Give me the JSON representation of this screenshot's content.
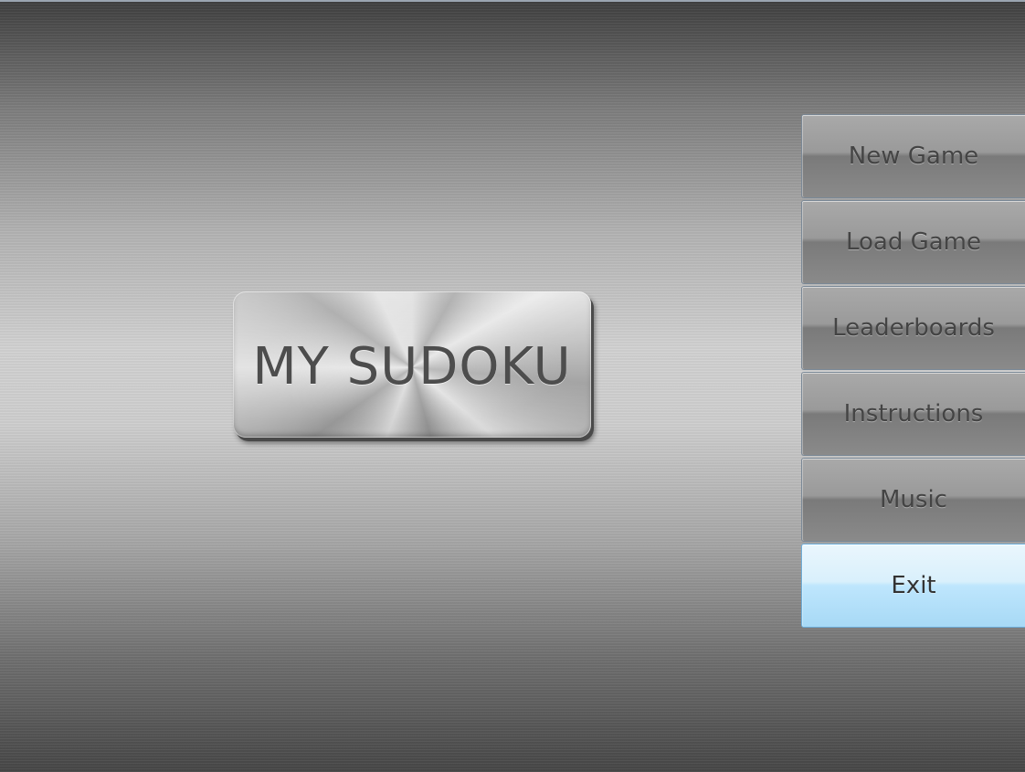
{
  "app": {
    "logo_text": "MY SUDOKU"
  },
  "menu": {
    "items": [
      {
        "id": "new-game",
        "label": "New Game"
      },
      {
        "id": "load-game",
        "label": "Load Game"
      },
      {
        "id": "leaderboards",
        "label": "Leaderboards"
      },
      {
        "id": "instructions",
        "label": "Instructions"
      },
      {
        "id": "music",
        "label": "Music"
      },
      {
        "id": "exit",
        "label": "Exit",
        "highlighted": true
      }
    ]
  },
  "colors": {
    "highlight": "#bee6fd",
    "button_face": "#9a9a9a",
    "label_text": "#444444"
  }
}
